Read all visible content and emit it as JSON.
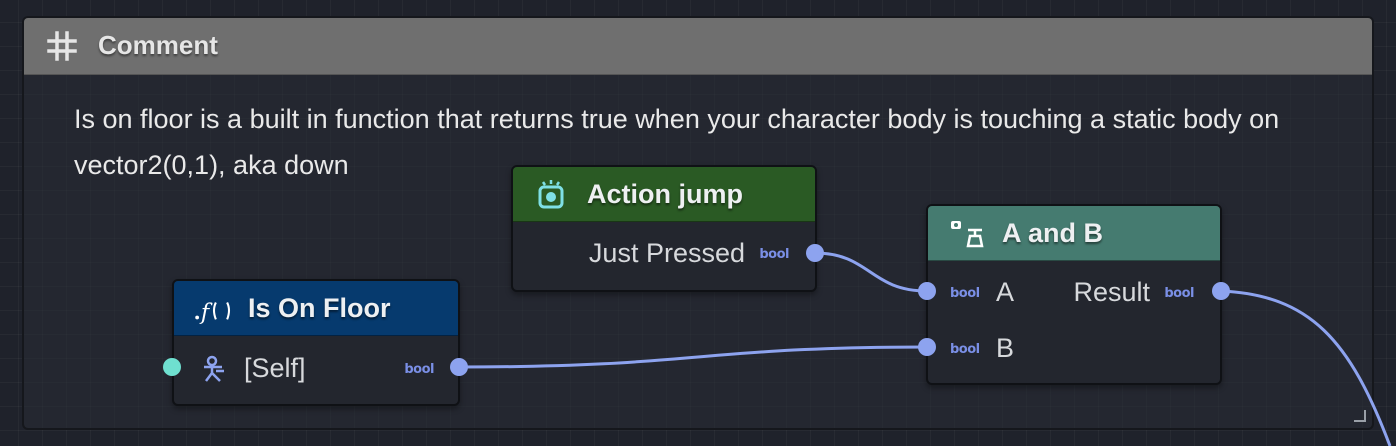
{
  "comment": {
    "title": "Comment",
    "text": "Is on floor is a built in function that returns true when your character body is touching a static body on vector2(0,1), aka down"
  },
  "nodes": {
    "action_jump": {
      "title": "Action jump",
      "header_color": "#2a5a24",
      "output_label": "Just Pressed",
      "output_type": "bool"
    },
    "a_and_b": {
      "title": "A and B",
      "header_color": "#457b70",
      "input_a_label": "A",
      "input_b_label": "B",
      "input_a_type": "bool",
      "input_b_type": "bool",
      "output_label": "Result",
      "output_type": "bool"
    },
    "is_on_floor": {
      "title": "Is On Floor",
      "header_color": "#063a6e",
      "input_label": "[Self]",
      "output_type": "bool"
    }
  },
  "colors": {
    "wire": "#8da3ef",
    "bool_port": "#8da3ef",
    "self_port": "#6fe0d0",
    "comment_header": "#6f6f6f"
  },
  "icons": {
    "comment": "hash-icon",
    "action_jump": "action-event-icon",
    "a_and_b": "logic-operator-icon",
    "is_on_floor": "function-icon",
    "self_input": "character-body-icon"
  }
}
